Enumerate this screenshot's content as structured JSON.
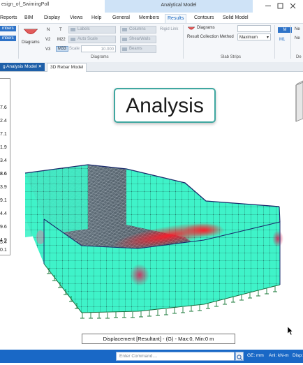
{
  "titlebar": {
    "document": "esign_of_SwimingPoll",
    "context_tab": "Analytical Model"
  },
  "menu_tabs": [
    "Reports",
    "BIM",
    "Display",
    "Views",
    "Help",
    "General",
    "Members",
    "Results",
    "Contours",
    "Solid Model"
  ],
  "ribbon": {
    "left_buttons": [
      "mbers",
      "mbers"
    ],
    "diagrams_label": "Diagrams",
    "force_labels": [
      "N",
      "T",
      "V2",
      "M22",
      "V3",
      "M33"
    ],
    "toggles": [
      "Labels",
      "Auto Scale"
    ],
    "scale_label": "Scale",
    "scale_value": "10.000",
    "structure_buttons": [
      "Columns",
      "ShearWalls",
      "Beams"
    ],
    "rigid_link": "Rigid Link",
    "group_diagrams": "Diagrams",
    "slab_diagrams": "Diagrams",
    "collection_label": "Result Collection Method",
    "collection_value": "Maximum",
    "group_slab": "Slab Strips",
    "m_labels": [
      "M",
      "M1"
    ],
    "right_buttons": [
      "Ne",
      "Ne"
    ],
    "group_de": "De"
  },
  "doc_tabs": [
    "g Analysis Model",
    "3D Rebar Model"
  ],
  "legend": {
    "values": [
      "7.6",
      "2.4",
      "7.1",
      "1.9",
      "3.4",
      "8.6",
      "3.9",
      "9.1",
      "4.4",
      "9.6",
      "4.9",
      "0.1",
      "5.4"
    ]
  },
  "overlay": {
    "title": "Analysis"
  },
  "caption": "Displacement [Resultant] - (G) -  Max:0, Min:0 m",
  "statusbar": {
    "command_placeholder": "Enter Command....",
    "items": [
      "GE: mm",
      "Anl: kN-m",
      "Disp:"
    ]
  },
  "colors": {
    "accent": "#1565c0",
    "status": "#1968c6",
    "model_fill": "#3df5c8",
    "stress_red": "#e8242c"
  }
}
